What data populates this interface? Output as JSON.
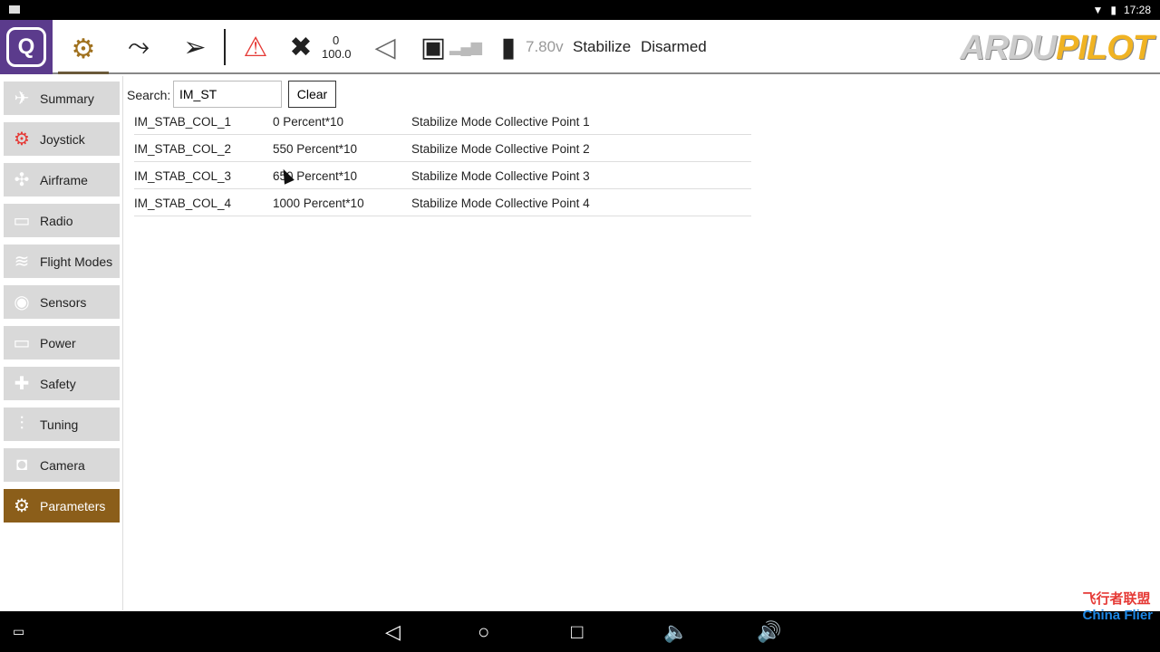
{
  "status": {
    "time": "17:28"
  },
  "toolbar": {
    "sat_count": "0",
    "hdop": "100.0",
    "voltage": "7.80v",
    "mode": "Stabilize",
    "arm_state": "Disarmed",
    "brand_a": "ARDU",
    "brand_b": "PILOT"
  },
  "sidebar": {
    "items": [
      {
        "label": "Summary",
        "icon": "plane-icon"
      },
      {
        "label": "Joystick",
        "icon": "joystick-icon"
      },
      {
        "label": "Airframe",
        "icon": "airframe-icon"
      },
      {
        "label": "Radio",
        "icon": "radio-icon"
      },
      {
        "label": "Flight Modes",
        "icon": "waves-icon"
      },
      {
        "label": "Sensors",
        "icon": "sensors-icon"
      },
      {
        "label": "Power",
        "icon": "battery-icon"
      },
      {
        "label": "Safety",
        "icon": "medkit-icon"
      },
      {
        "label": "Tuning",
        "icon": "sliders-icon"
      },
      {
        "label": "Camera",
        "icon": "camera-icon"
      },
      {
        "label": "Parameters",
        "icon": "gears-icon"
      }
    ],
    "active": "Parameters"
  },
  "search": {
    "label": "Search:",
    "value": "IM_ST",
    "clear_label": "Clear"
  },
  "params": [
    {
      "name": "IM_STAB_COL_1",
      "value": "0 Percent*10",
      "desc": "Stabilize Mode Collective Point 1"
    },
    {
      "name": "IM_STAB_COL_2",
      "value": "550 Percent*10",
      "desc": "Stabilize Mode Collective Point 2"
    },
    {
      "name": "IM_STAB_COL_3",
      "value": "650 Percent*10",
      "desc": "Stabilize Mode Collective Point 3"
    },
    {
      "name": "IM_STAB_COL_4",
      "value": "1000 Percent*10",
      "desc": "Stabilize Mode Collective Point 4"
    }
  ],
  "watermark": {
    "cn": "飞行者联盟",
    "en": "China Flier"
  }
}
